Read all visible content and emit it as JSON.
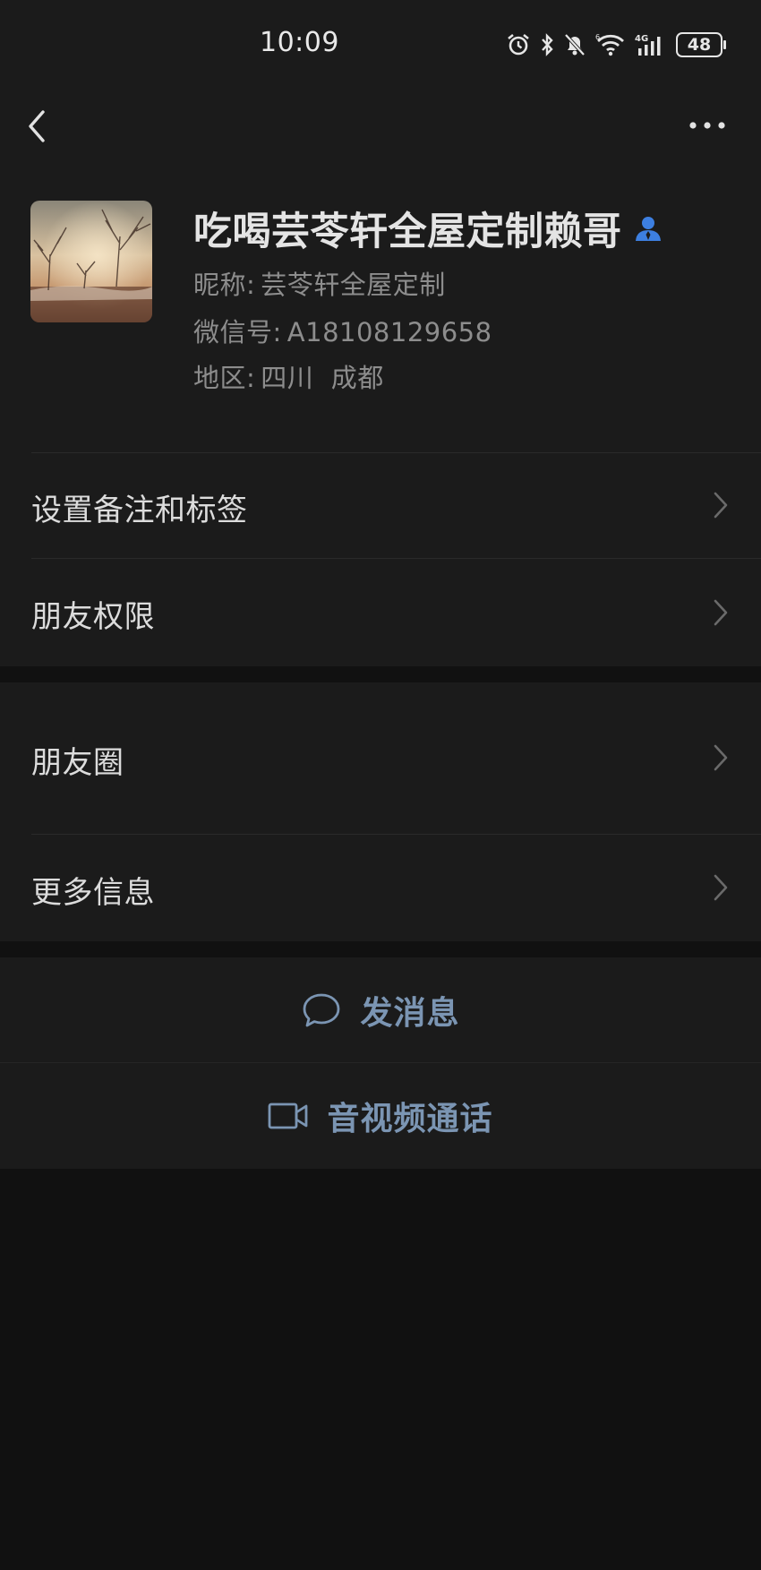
{
  "status_bar": {
    "time": "10:09",
    "battery": "48",
    "icons": [
      "alarm-icon",
      "bluetooth-icon",
      "mute-bell-icon",
      "wifi-icon",
      "4g-signal-icon",
      "battery-icon"
    ]
  },
  "nav": {
    "back_icon": "chevron-left-icon",
    "more_icon": "more-dots-icon"
  },
  "profile": {
    "display_name": "吃喝芸苓轩全屋定制赖哥",
    "nickname_label": "昵称:",
    "nickname": "芸苓轩全屋定制",
    "wechat_id_label": "微信号:",
    "wechat_id": "A18108129658",
    "region_label": "地区:",
    "region": "四川  成都",
    "badge_icon": "person-icon",
    "badge_color": "#3d7fe0"
  },
  "menu": {
    "remark_tags": "设置备注和标签",
    "friend_permissions": "朋友权限",
    "moments": "朋友圈",
    "more_info": "更多信息"
  },
  "actions": {
    "send_message": "发消息",
    "av_call": "音视频通话",
    "accent_color": "#7b95b3"
  }
}
